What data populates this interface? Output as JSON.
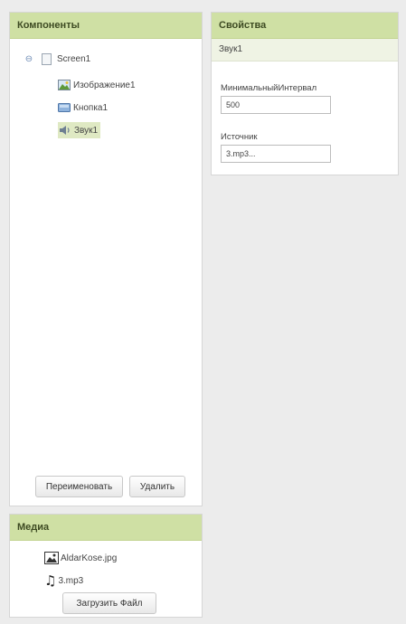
{
  "components": {
    "header": "Компоненты",
    "tree": {
      "root": {
        "label": "Screen1",
        "toggle": "⊖",
        "icon": "screen-icon"
      },
      "children": [
        {
          "label": "Изображение1",
          "icon": "image-icon"
        },
        {
          "label": "Кнопка1",
          "icon": "button-icon"
        },
        {
          "label": "Звук1",
          "icon": "sound-icon",
          "selected": true
        }
      ]
    },
    "rename_button": "Переименовать",
    "delete_button": "Удалить"
  },
  "properties": {
    "header": "Свойства",
    "component_name": "Звук1",
    "fields": [
      {
        "label": "МинимальныйИнтервал",
        "value": "500"
      },
      {
        "label": "Источник",
        "value": "3.mp3..."
      }
    ]
  },
  "media": {
    "header": "Медиа",
    "files": [
      {
        "name": "AldarKose.jpg",
        "icon": "image-file-icon"
      },
      {
        "name": "3.mp3",
        "icon": "music-note-icon"
      }
    ],
    "upload_button": "Загрузить Файл"
  },
  "colors": {
    "header_bg": "#cfe0a4",
    "selected_bg": "#dfe9c3",
    "page_bg": "#ececec"
  }
}
